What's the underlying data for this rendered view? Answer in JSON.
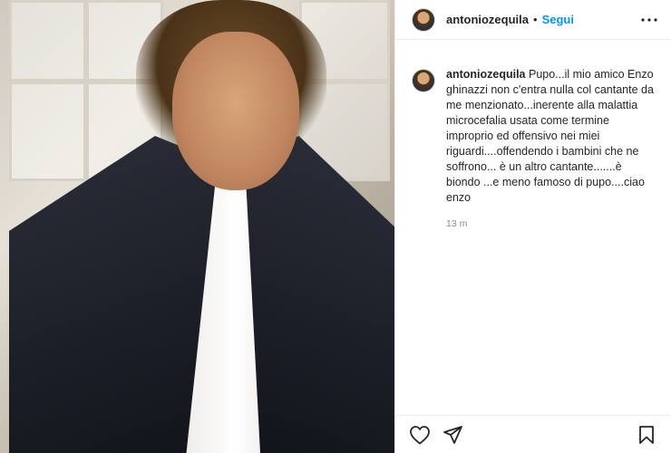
{
  "post": {
    "username": "antoniozequila",
    "separator": "•",
    "follow_label": "Segui",
    "caption": "Pupo...il mio amico Enzo ghinazzi non c'entra nulla col cantante da me menzionato...inerente alla malattia microcefalia usata come termine improprio ed offensivo nei miei riguardi....offendendo i bambini che ne soffrono... è un altro cantante.......è biondo ...e meno famoso di pupo....ciao enzo",
    "timestamp": "13 m"
  },
  "icons": {
    "more": "more-horizontal-icon",
    "like": "heart-icon",
    "share": "paper-plane-icon",
    "save": "bookmark-icon"
  },
  "colors": {
    "accent": "#0095f6",
    "text": "#262626",
    "muted": "#8e8e8e"
  }
}
